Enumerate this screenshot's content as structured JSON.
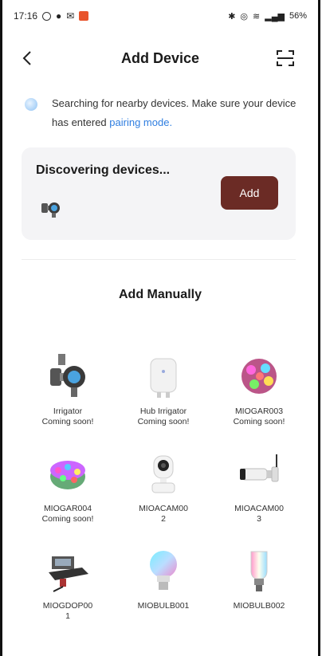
{
  "status_bar": {
    "time": "17:16",
    "right_text": "56%"
  },
  "header": {
    "title": "Add Device"
  },
  "search_hint": {
    "text": "Searching for nearby devices. Make sure your device has entered ",
    "link": "pairing mode."
  },
  "discover": {
    "label": "Discovering devices...",
    "add_label": "Add"
  },
  "manual": {
    "title": "Add Manually",
    "items": [
      {
        "name": "Irrigator",
        "sub": "Coming soon!",
        "icon": "irrigator-icon"
      },
      {
        "name": "Hub Irrigator",
        "sub": "Coming soon!",
        "icon": "hub-icon"
      },
      {
        "name": "MIOGAR003",
        "sub": "Coming soon!",
        "icon": "light-string-icon"
      },
      {
        "name": "MIOGAR004",
        "sub": "Coming soon!",
        "icon": "light-string-icon"
      },
      {
        "name": "MIOACAM00",
        "sub": "2",
        "icon": "indoor-camera-icon"
      },
      {
        "name": "MIOACAM00",
        "sub": "3",
        "icon": "outdoor-camera-icon"
      },
      {
        "name": "MIOGDOP00",
        "sub": "1",
        "icon": "garage-door-icon"
      },
      {
        "name": "MIOBULB001",
        "sub": "",
        "icon": "bulb-icon"
      },
      {
        "name": "MIOBULB002",
        "sub": "",
        "icon": "bulb-icon"
      }
    ]
  },
  "colors": {
    "accent_link": "#2f7ee0",
    "add_button": "#6b2b25",
    "card_bg": "#f4f4f6"
  }
}
